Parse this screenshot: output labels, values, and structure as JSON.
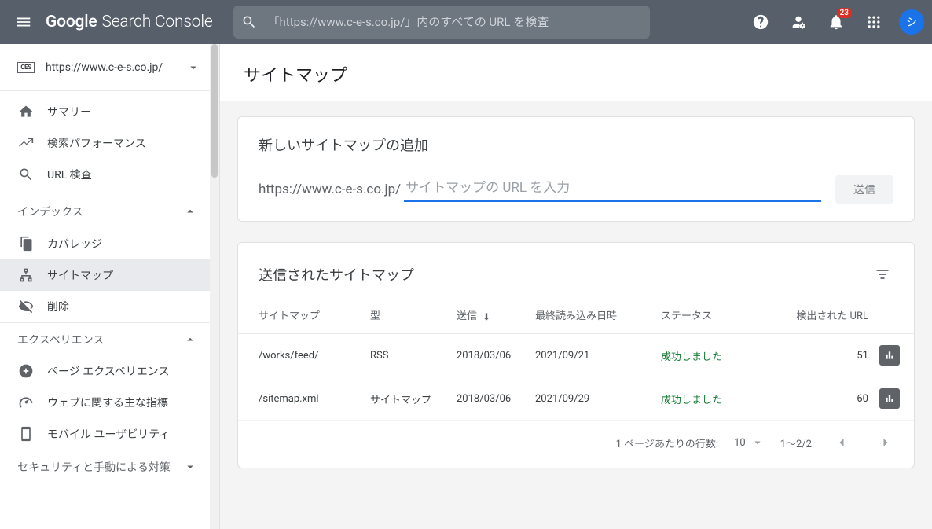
{
  "header": {
    "product_a": "Google",
    "product_b": "Search Console",
    "search_placeholder": "「https://www.c-e-s.co.jp/」内のすべての URL を検査",
    "notif_count": "23",
    "avatar_letter": "シ"
  },
  "sidebar": {
    "property": {
      "icon_text": "CES",
      "url": "https://www.c-e-s.co.jp/"
    },
    "items_top": [
      {
        "label": "サマリー"
      },
      {
        "label": "検索パフォーマンス"
      },
      {
        "label": "URL 検査"
      }
    ],
    "group_index": "インデックス",
    "items_index": [
      {
        "label": "カバレッジ"
      },
      {
        "label": "サイトマップ"
      },
      {
        "label": "削除"
      }
    ],
    "group_exp": "エクスペリエンス",
    "items_exp": [
      {
        "label": "ページ エクスペリエンス"
      },
      {
        "label": "ウェブに関する主な指標"
      },
      {
        "label": "モバイル ユーザビリティ"
      }
    ],
    "group_sec": "セキュリティと手動による対策"
  },
  "page": {
    "title": "サイトマップ",
    "add": {
      "heading": "新しいサイトマップの追加",
      "prefix": "https://www.c-e-s.co.jp/",
      "placeholder": "サイトマップの URL を入力",
      "button": "送信"
    },
    "list": {
      "heading": "送信されたサイトマップ",
      "columns": {
        "sitemap": "サイトマップ",
        "type": "型",
        "sent": "送信",
        "last_read": "最終読み込み日時",
        "status": "ステータス",
        "found": "検出された URL"
      },
      "rows": [
        {
          "sitemap": "/works/feed/",
          "type": "RSS",
          "sent": "2018/03/06",
          "last_read": "2021/09/21",
          "status": "成功しました",
          "found": "51"
        },
        {
          "sitemap": "/sitemap.xml",
          "type": "サイトマップ",
          "sent": "2018/03/06",
          "last_read": "2021/09/29",
          "status": "成功しました",
          "found": "60"
        }
      ],
      "pager": {
        "rows_label": "1 ページあたりの行数:",
        "rows_value": "10",
        "range": "1～2/2"
      }
    }
  }
}
